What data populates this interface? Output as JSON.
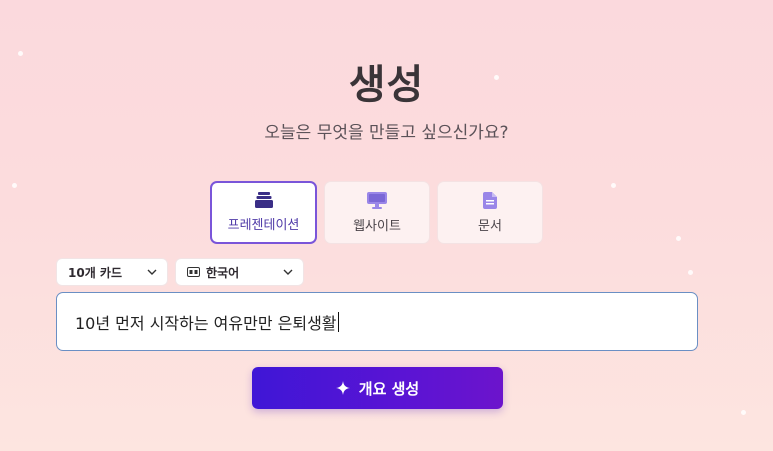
{
  "header": {
    "title": "생성",
    "subtitle": "오늘은 무엇을 만들고 싶으신가요?"
  },
  "type_options": [
    {
      "label": "프레젠테이션",
      "icon": "presentation-stack-icon",
      "selected": true
    },
    {
      "label": "웹사이트",
      "icon": "monitor-icon",
      "selected": false
    },
    {
      "label": "문서",
      "icon": "document-icon",
      "selected": false
    }
  ],
  "settings": {
    "card_count": {
      "value": "10개 카드",
      "icon": "chevron-down-icon"
    },
    "language": {
      "value": "한국어",
      "icon": "language-icon"
    }
  },
  "prompt": {
    "value": "10년 먼저 시작하는 여유만만 은퇴생활"
  },
  "generate_button": {
    "label": "개요 생성",
    "icon": "sparkle-icon"
  },
  "colors": {
    "accent": "#5a14d4",
    "selected_border": "#7a55d9",
    "icon_purple": "#9a86e8"
  }
}
